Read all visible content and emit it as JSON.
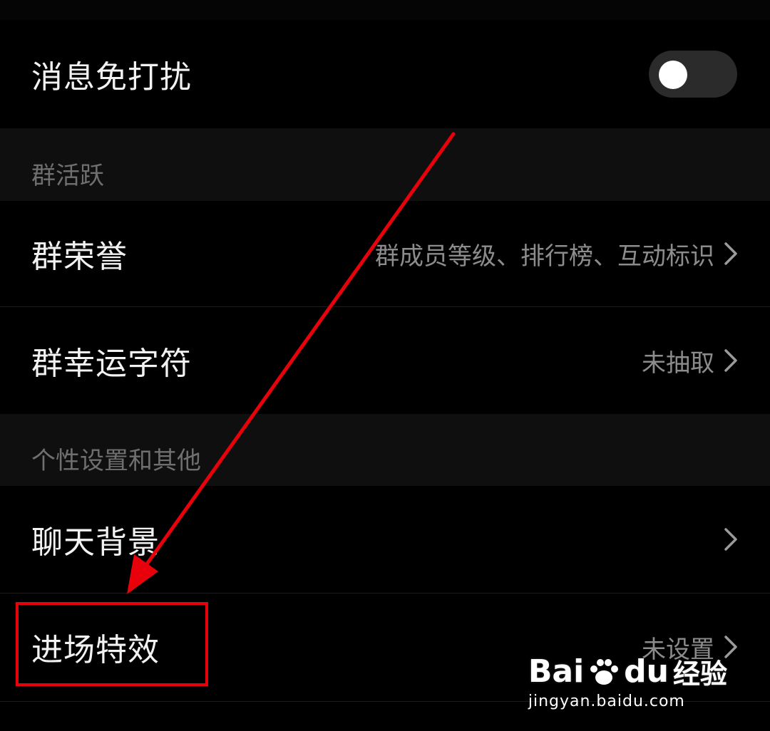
{
  "rows": {
    "dnd": {
      "label": "消息免打扰",
      "toggle_on": false
    },
    "honor": {
      "label": "群荣誉",
      "value": "群成员等级、排行榜、互动标识"
    },
    "lucky": {
      "label": "群幸运字符",
      "value": "未抽取"
    },
    "background": {
      "label": "聊天背景",
      "value": ""
    },
    "entrance": {
      "label": "进场特效",
      "value": "未设置"
    }
  },
  "sections": {
    "activity": "群活跃",
    "personal": "个性设置和其他"
  },
  "annotation": {
    "highlight_color": "#e8000b",
    "arrow_color": "#e8000b"
  },
  "watermark": {
    "brand_left": "Bai",
    "brand_right": "du",
    "brand_suffix": "经验",
    "url": "jingyan.baidu.com"
  },
  "colors": {
    "background": "#000000",
    "section_bg": "#0f0f0f",
    "label": "#f2f2f2",
    "value": "#8c8c8c",
    "toggle_track": "#2b2b2b",
    "toggle_knob": "#ffffff"
  }
}
